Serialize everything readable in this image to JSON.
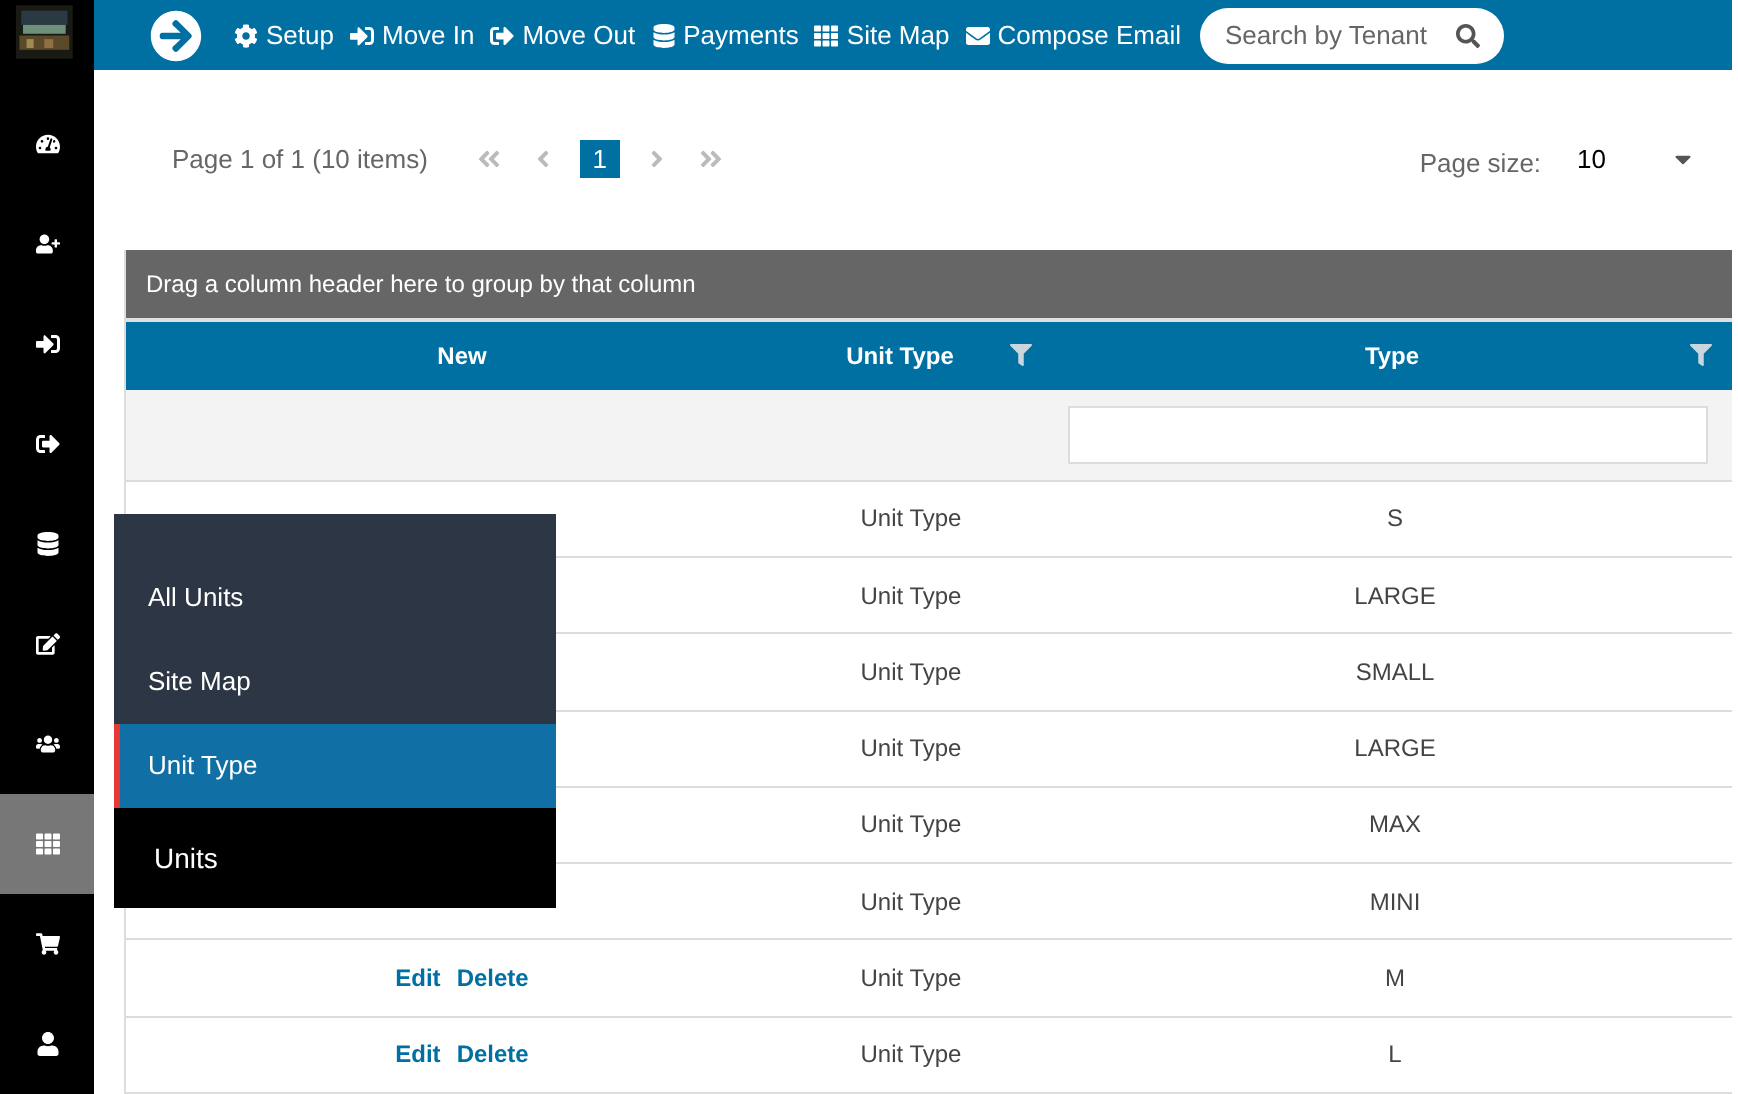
{
  "sidebar": {
    "items": [
      {
        "selected": false
      },
      {
        "selected": false
      },
      {
        "selected": false
      },
      {
        "selected": false
      },
      {
        "selected": false
      },
      {
        "selected": false
      },
      {
        "selected": false
      },
      {
        "selected": true
      },
      {
        "selected": false
      },
      {
        "selected": false
      }
    ]
  },
  "toolbar": {
    "items": [
      {
        "label": "Setup"
      },
      {
        "label": "Move In"
      },
      {
        "label": "Move Out"
      },
      {
        "label": "Payments"
      },
      {
        "label": "Site Map"
      },
      {
        "label": "Compose Email"
      }
    ],
    "search": {
      "placeholder": "Search by Tenant"
    }
  },
  "pager": {
    "info": "Page 1 of 1 (10 items)",
    "pages": [
      {
        "label": "1",
        "selected": true
      }
    ],
    "page_size_label": "Page size:",
    "page_size": "10"
  },
  "grid": {
    "group_panel": "Drag a column header here to group by that column",
    "columns": [
      {
        "title": "New",
        "filter": false
      },
      {
        "title": "Unit Type",
        "filter": true
      },
      {
        "title": "Type",
        "filter": true
      }
    ],
    "rows": [
      {
        "unit_type": "Unit Type",
        "type": "S"
      },
      {
        "unit_type": "Unit Type",
        "type": "LARGE"
      },
      {
        "unit_type": "Unit Type",
        "type": "SMALL"
      },
      {
        "unit_type": "Unit Type",
        "type": "LARGE"
      },
      {
        "unit_type": "Unit Type",
        "type": "MAX"
      },
      {
        "unit_type": "Unit Type",
        "type": "MINI"
      },
      {
        "actions": [
          "Edit",
          "Delete"
        ],
        "unit_type": "Unit Type",
        "type": "M"
      },
      {
        "actions": [
          "Edit",
          "Delete"
        ],
        "unit_type": "Unit Type",
        "type": "L"
      }
    ]
  },
  "flyout": {
    "items": [
      {
        "label": "All Units",
        "kind": "sub",
        "selected": false
      },
      {
        "label": "Site Map",
        "kind": "sub",
        "selected": false
      },
      {
        "label": "Unit Type",
        "kind": "sub",
        "selected": true
      },
      {
        "label": "Units",
        "kind": "title"
      }
    ]
  }
}
